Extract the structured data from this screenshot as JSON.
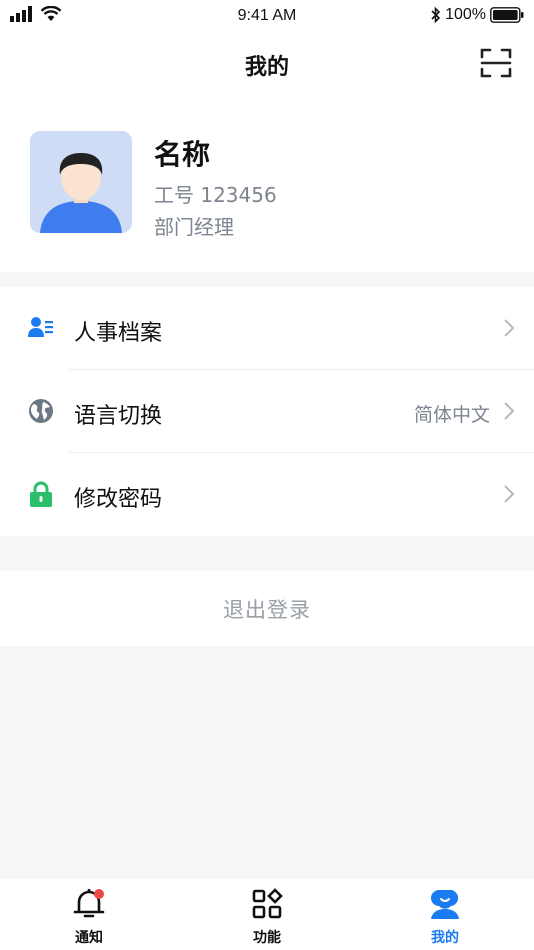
{
  "status_bar": {
    "time": "9:41 AM",
    "battery": "100%"
  },
  "nav": {
    "title": "我的",
    "scan_icon": "scan-icon"
  },
  "profile": {
    "name": "名称",
    "employee_id": "工号 123456",
    "department": "部门经理"
  },
  "menu": {
    "items": [
      {
        "icon": "contact-card-icon",
        "label": "人事档案",
        "value": "",
        "icon_color": "#1a7cf0"
      },
      {
        "icon": "globe-icon",
        "label": "语言切换",
        "value": "简体中文",
        "icon_color": "#6b7785"
      },
      {
        "icon": "lock-icon",
        "label": "修改密码",
        "value": "",
        "icon_color": "#2cbf6b"
      }
    ]
  },
  "logout": {
    "label": "退出登录"
  },
  "tabbar": {
    "tabs": [
      {
        "icon": "bell-icon",
        "label": "通知",
        "badge": true,
        "active": false
      },
      {
        "icon": "apps-grid-icon",
        "label": "功能",
        "active": false
      },
      {
        "icon": "person-icon",
        "label": "我的",
        "active": true
      }
    ],
    "active_color": "#1a7cf0",
    "badge_color": "#f04848"
  }
}
